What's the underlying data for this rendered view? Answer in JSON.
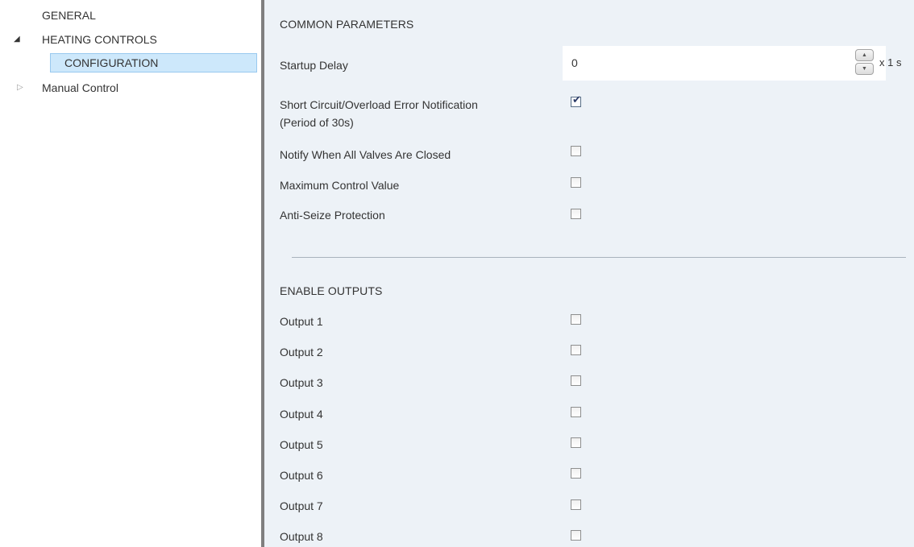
{
  "sidebar": {
    "items": [
      {
        "label": "GENERAL",
        "arrow": "",
        "state": "leaf"
      },
      {
        "label": "HEATING CONTROLS",
        "arrow": "◢",
        "state": "expanded"
      },
      {
        "label": "CONFIGURATION",
        "arrow": "",
        "state": "selected"
      },
      {
        "label": "Manual Control",
        "arrow": "▷",
        "state": "collapsed"
      }
    ]
  },
  "main": {
    "common_title": "COMMON PARAMETERS",
    "startup_delay": {
      "label": "Startup Delay",
      "value": "0",
      "unit": "x 1 s"
    },
    "params": [
      {
        "label": "Short Circuit/Overload Error Notification",
        "label2": "(Period of 30s)",
        "checked": true
      },
      {
        "label": "Notify When All Valves Are Closed",
        "checked": false
      },
      {
        "label": "Maximum Control Value",
        "checked": false
      },
      {
        "label": "Anti-Seize Protection",
        "checked": false
      }
    ],
    "outputs_title": "ENABLE OUTPUTS",
    "outputs": [
      {
        "label": "Output 1",
        "checked": false
      },
      {
        "label": "Output 2",
        "checked": false
      },
      {
        "label": "Output 3",
        "checked": false
      },
      {
        "label": "Output 4",
        "checked": false
      },
      {
        "label": "Output 5",
        "checked": false
      },
      {
        "label": "Output 6",
        "checked": false
      },
      {
        "label": "Output 7",
        "checked": false
      },
      {
        "label": "Output 8",
        "checked": false
      }
    ]
  },
  "icons": {
    "check": "check-icon",
    "spin_up": "arrow-up-icon",
    "spin_down": "arrow-down-icon",
    "expanded": "tree-expanded-icon",
    "collapsed": "tree-collapsed-icon"
  },
  "colors": {
    "panel_bg": "#edf2f7",
    "selection_bg": "#cde8fb",
    "selection_border": "#99c9ef",
    "splitter": "#7f7f7f"
  }
}
